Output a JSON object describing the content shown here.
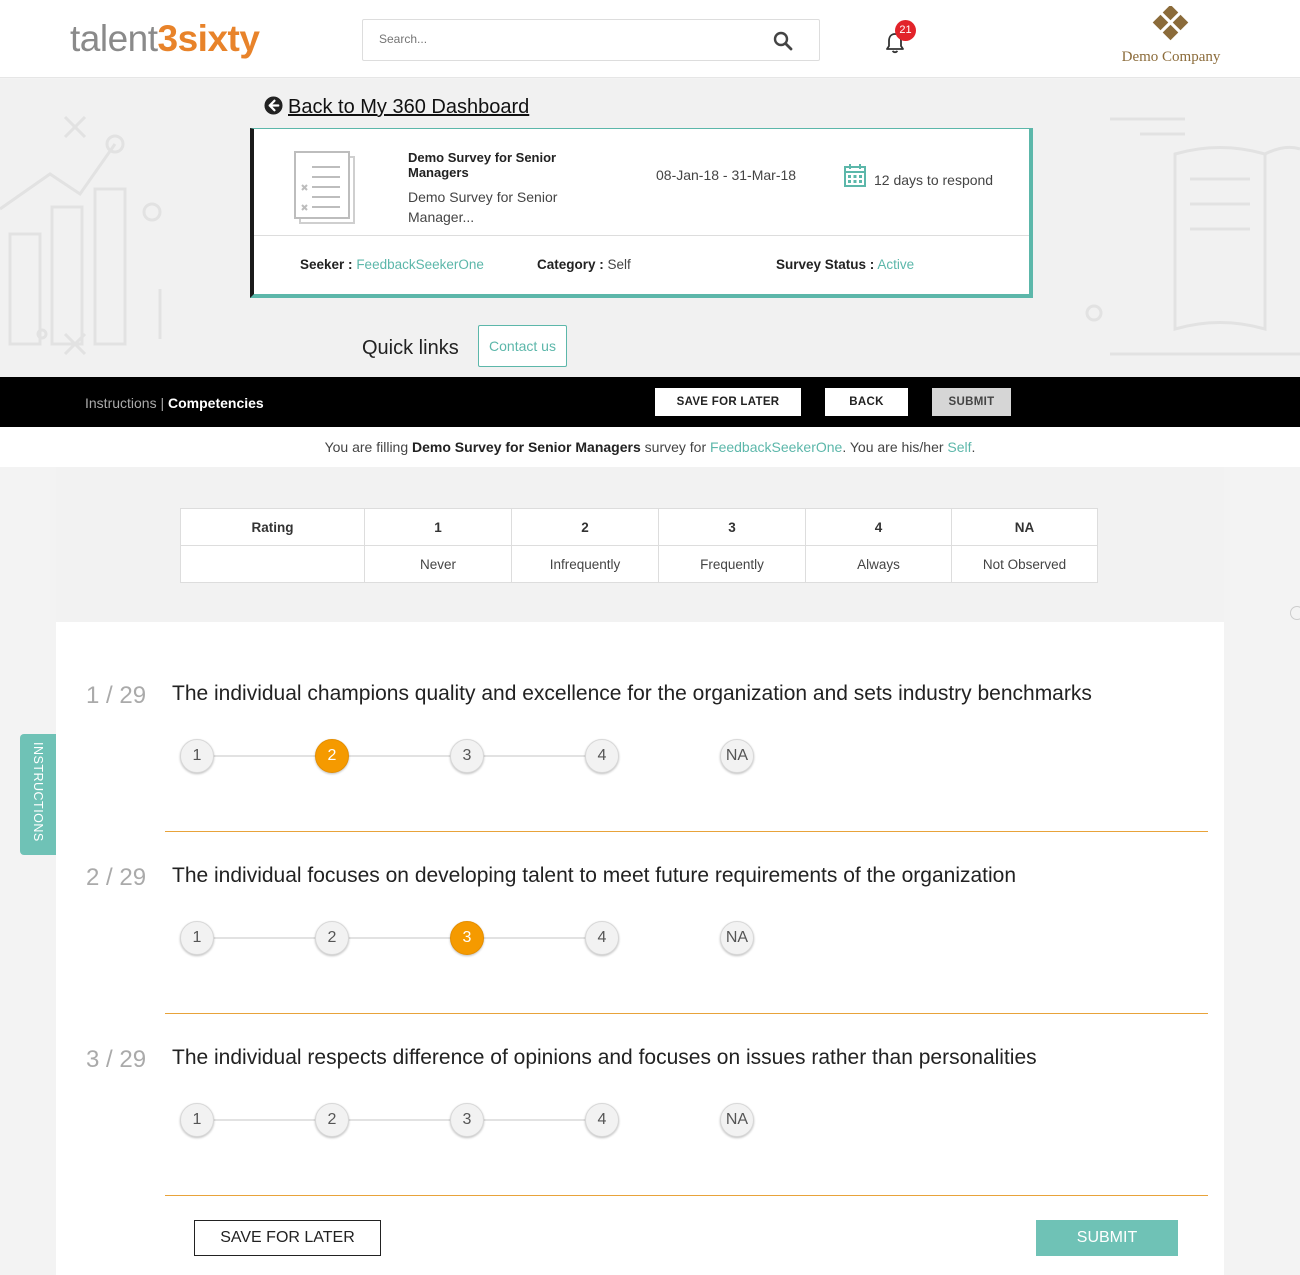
{
  "brand": {
    "logo_part1": "talent",
    "logo_part2": "3sixty",
    "company_name": "Demo Company"
  },
  "search": {
    "placeholder": "Search..."
  },
  "notifications": {
    "count": "21"
  },
  "back_link": "Back to My 360 Dashboard",
  "survey": {
    "title": "Demo Survey for Senior Managers",
    "description": "Demo Survey for Senior Manager...",
    "dates": "08-Jan-18 - 31-Mar-18",
    "respond": "12 days to respond",
    "seeker_label": "Seeker :",
    "seeker_value": "FeedbackSeekerOne",
    "category_label": "Category :",
    "category_value": "Self",
    "status_label": "Survey Status :",
    "status_value": "Active"
  },
  "quick_links": {
    "label": "Quick links",
    "contact": "Contact us"
  },
  "bar": {
    "crumb_instructions": "Instructions",
    "crumb_sep": " | ",
    "crumb_current": "Competencies",
    "save_label": "SAVE FOR LATER",
    "back_label": "BACK",
    "submit_label": "SUBMIT"
  },
  "fill_note": {
    "p1": "You are filling ",
    "survey": "Demo Survey for Senior Managers",
    "p2": " survey for ",
    "seeker": "FeedbackSeekerOne",
    "p3": ". You are his/her ",
    "role": "Self",
    "p4": "."
  },
  "rating_scale": {
    "header": "Rating",
    "columns": [
      {
        "value": "1",
        "label": "Never"
      },
      {
        "value": "2",
        "label": "Infrequently"
      },
      {
        "value": "3",
        "label": "Frequently"
      },
      {
        "value": "4",
        "label": "Always"
      },
      {
        "value": "NA",
        "label": "Not Observed"
      }
    ]
  },
  "questions": [
    {
      "number": "1 / 29",
      "text": "The individual champions quality and excellence for the organization and sets industry benchmarks",
      "selected": "2"
    },
    {
      "number": "2 / 29",
      "text": "The individual focuses on developing talent to meet future requirements of the organization",
      "selected": "3"
    },
    {
      "number": "3 / 29",
      "text": "The individual respects difference of opinions and focuses on issues rather than personalities",
      "selected": ""
    }
  ],
  "options": [
    "1",
    "2",
    "3",
    "4",
    "NA"
  ],
  "bottom": {
    "save_label": "SAVE FOR LATER",
    "submit_label": "SUBMIT"
  },
  "instructions_tab": "INSTRUCTIONS",
  "colors": {
    "accent": "#5cb7aa",
    "selected": "#f59a00",
    "brand_orange": "#e8832a",
    "company": "#8b6b3a"
  }
}
